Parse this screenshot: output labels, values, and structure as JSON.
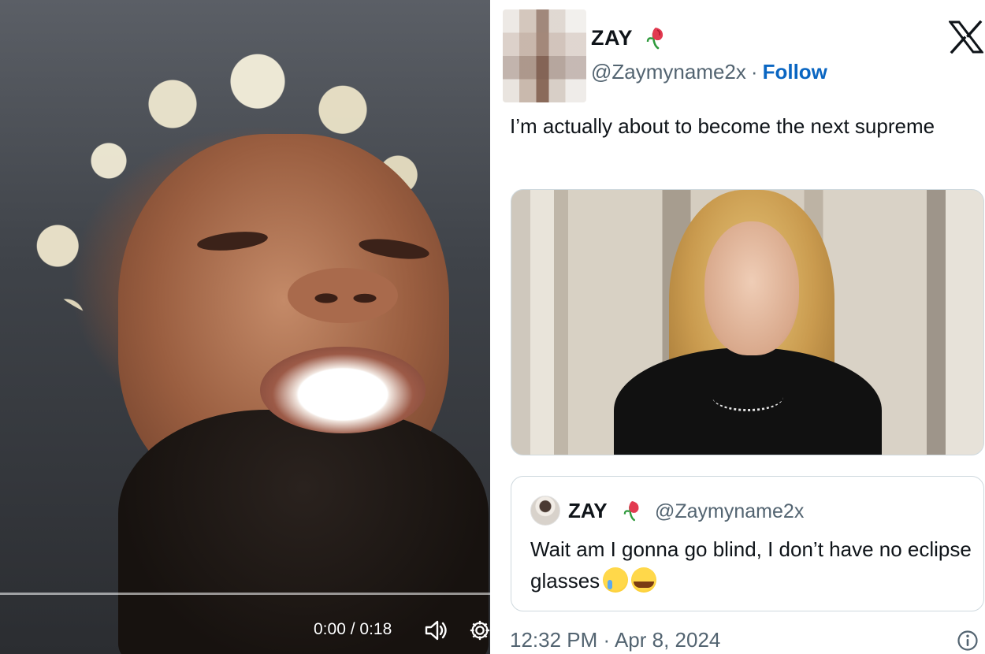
{
  "video": {
    "current_time": "0:00",
    "separator": " / ",
    "duration": "0:18",
    "progress": 0,
    "icons": [
      "volume-icon",
      "settings-gear-icon"
    ]
  },
  "tweet": {
    "author_name": "ZAY",
    "author_handle": "@Zaymyname2x",
    "dot": "·",
    "follow_label": "Follow",
    "text": "I’m actually about to become the next supreme",
    "timestamp": "12:32 PM · Apr 8, 2024",
    "quoted": {
      "author_name": "ZAY",
      "author_handle": "@Zaymyname2x",
      "text": "Wait am I gonna go blind, I don’t have no eclipse glasses"
    },
    "icons": [
      "x-logo-icon",
      "rose-emoji-icon",
      "info-icon"
    ]
  },
  "colors": {
    "link_blue": "#0a66c2",
    "secondary_text": "#536471",
    "border": "#cfd9de",
    "progress_accent": "#1d9bf0"
  }
}
